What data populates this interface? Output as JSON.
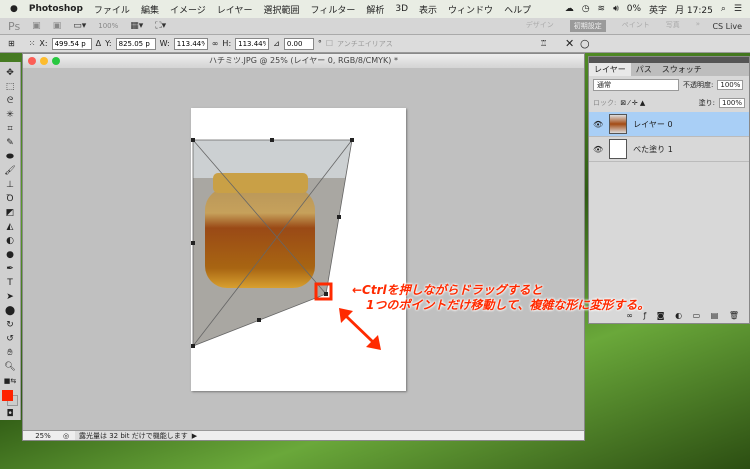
{
  "menubar": {
    "app": "Photoshop",
    "items": [
      "ファイル",
      "編集",
      "イメージ",
      "レイヤー",
      "選択範囲",
      "フィルター",
      "解析",
      "3D",
      "表示",
      "ウィンドウ",
      "ヘルプ"
    ],
    "battery": "0%",
    "input": "英字",
    "clock": "月 17:25"
  },
  "appbar": {
    "zoom": "100%",
    "workspaces": [
      "デザイン",
      "初期設定",
      "ペイント",
      "写真"
    ],
    "cslive": "CS Live"
  },
  "options": {
    "x_label": "X:",
    "x": "499.54 p",
    "y_label": "Y:",
    "y": "825.05 p",
    "w_label": "W:",
    "w": "113.44%",
    "h_label": "H:",
    "h": "113.44%",
    "angle": "0.00",
    "deg": "°",
    "antialias": "アンチエイリアス"
  },
  "document": {
    "title": "ハチミツ.JPG @ 25% (レイヤー 0, RGB/8/CMYK) *",
    "zoom": "25%",
    "status": "露光量は 32 bit だけで機能します"
  },
  "layers": {
    "tabs": [
      "レイヤー",
      "パス",
      "スウォッチ"
    ],
    "blend": "通常",
    "opacity_label": "不透明度:",
    "opacity": "100%",
    "lock_label": "ロック:",
    "fill_label": "塗り:",
    "fill": "100%",
    "items": [
      {
        "name": "レイヤー 0",
        "selected": true
      },
      {
        "name": "べた塗り 1",
        "selected": false
      }
    ]
  },
  "callout": {
    "line1": "←Ctrlを押しながらドラッグすると",
    "line2": "1つのポイントだけ移動して、複雑な形に変形する。"
  },
  "colors": {
    "accent": "#ff2a00",
    "selection": "#a9cff6"
  }
}
